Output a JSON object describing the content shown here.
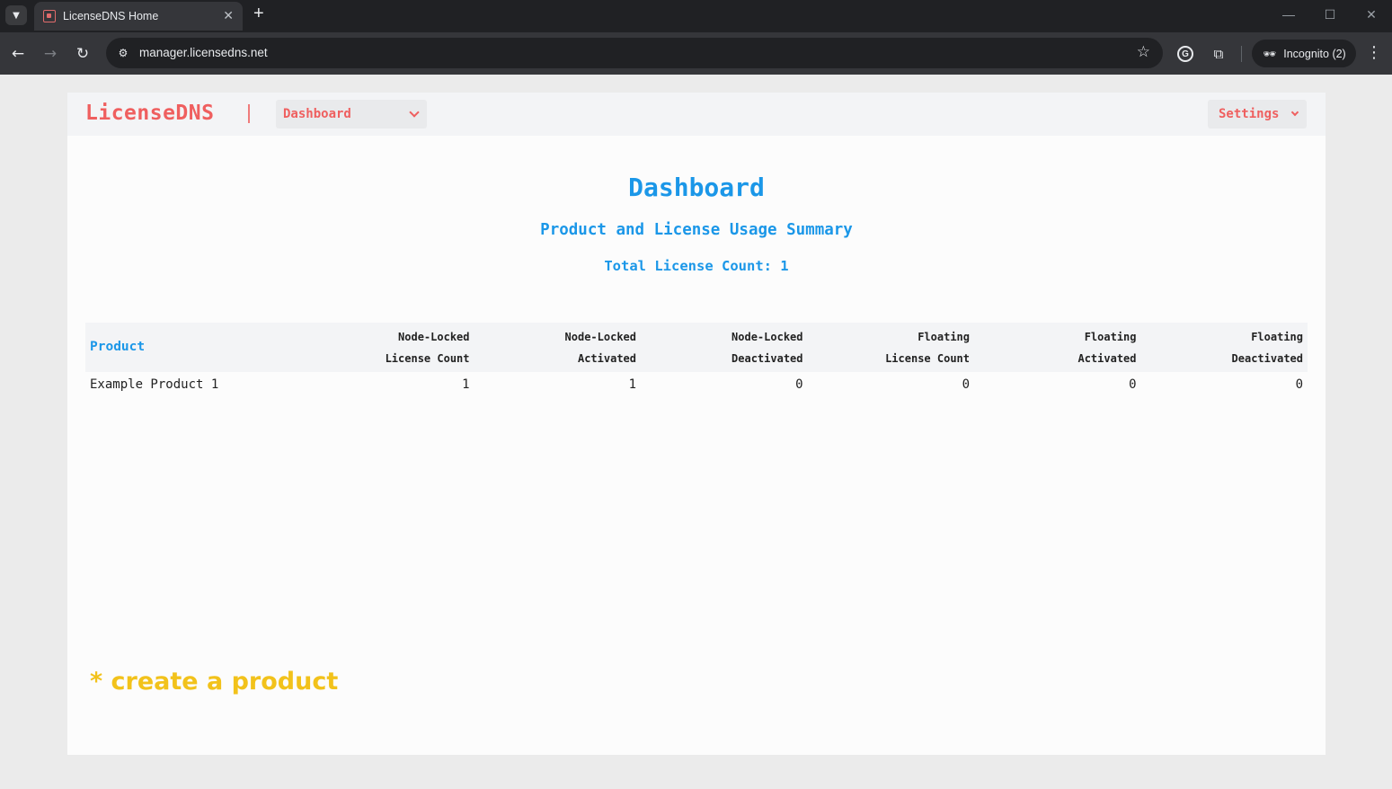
{
  "browser": {
    "tab_title": "LicenseDNS Home",
    "url": "manager.licensedns.net",
    "incognito_label": "Incognito (2)"
  },
  "app": {
    "brand": "LicenseDNS",
    "nav_select": "Dashboard",
    "settings_label": "Settings"
  },
  "main": {
    "title": "Dashboard",
    "subtitle": "Product and License Usage Summary",
    "total_license_count": "Total License Count: 1"
  },
  "table": {
    "headers": [
      {
        "line1": "Product",
        "line2": ""
      },
      {
        "line1": "Node-Locked",
        "line2": "License Count"
      },
      {
        "line1": "Node-Locked",
        "line2": "Activated"
      },
      {
        "line1": "Node-Locked",
        "line2": "Deactivated"
      },
      {
        "line1": "Floating",
        "line2": "License Count"
      },
      {
        "line1": "Floating",
        "line2": "Activated"
      },
      {
        "line1": "Floating",
        "line2": "Deactivated"
      }
    ],
    "rows": [
      [
        "Example Product 1",
        "1",
        "1",
        "0",
        "0",
        "0",
        "0"
      ]
    ]
  },
  "create_link": "* create a product",
  "colors": {
    "brand": "#ef5f5f",
    "accent_blue": "#1b97e8",
    "cta_yellow": "#f2c21b"
  },
  "icons": [
    "tab-list-icon",
    "favicon-icon",
    "close-icon",
    "new-tab-icon",
    "back-icon",
    "forward-icon",
    "reload-icon",
    "site-info-icon",
    "star-icon",
    "grammarly-icon",
    "extensions-icon",
    "incognito-icon",
    "more-icon",
    "chevron-down-icon"
  ]
}
